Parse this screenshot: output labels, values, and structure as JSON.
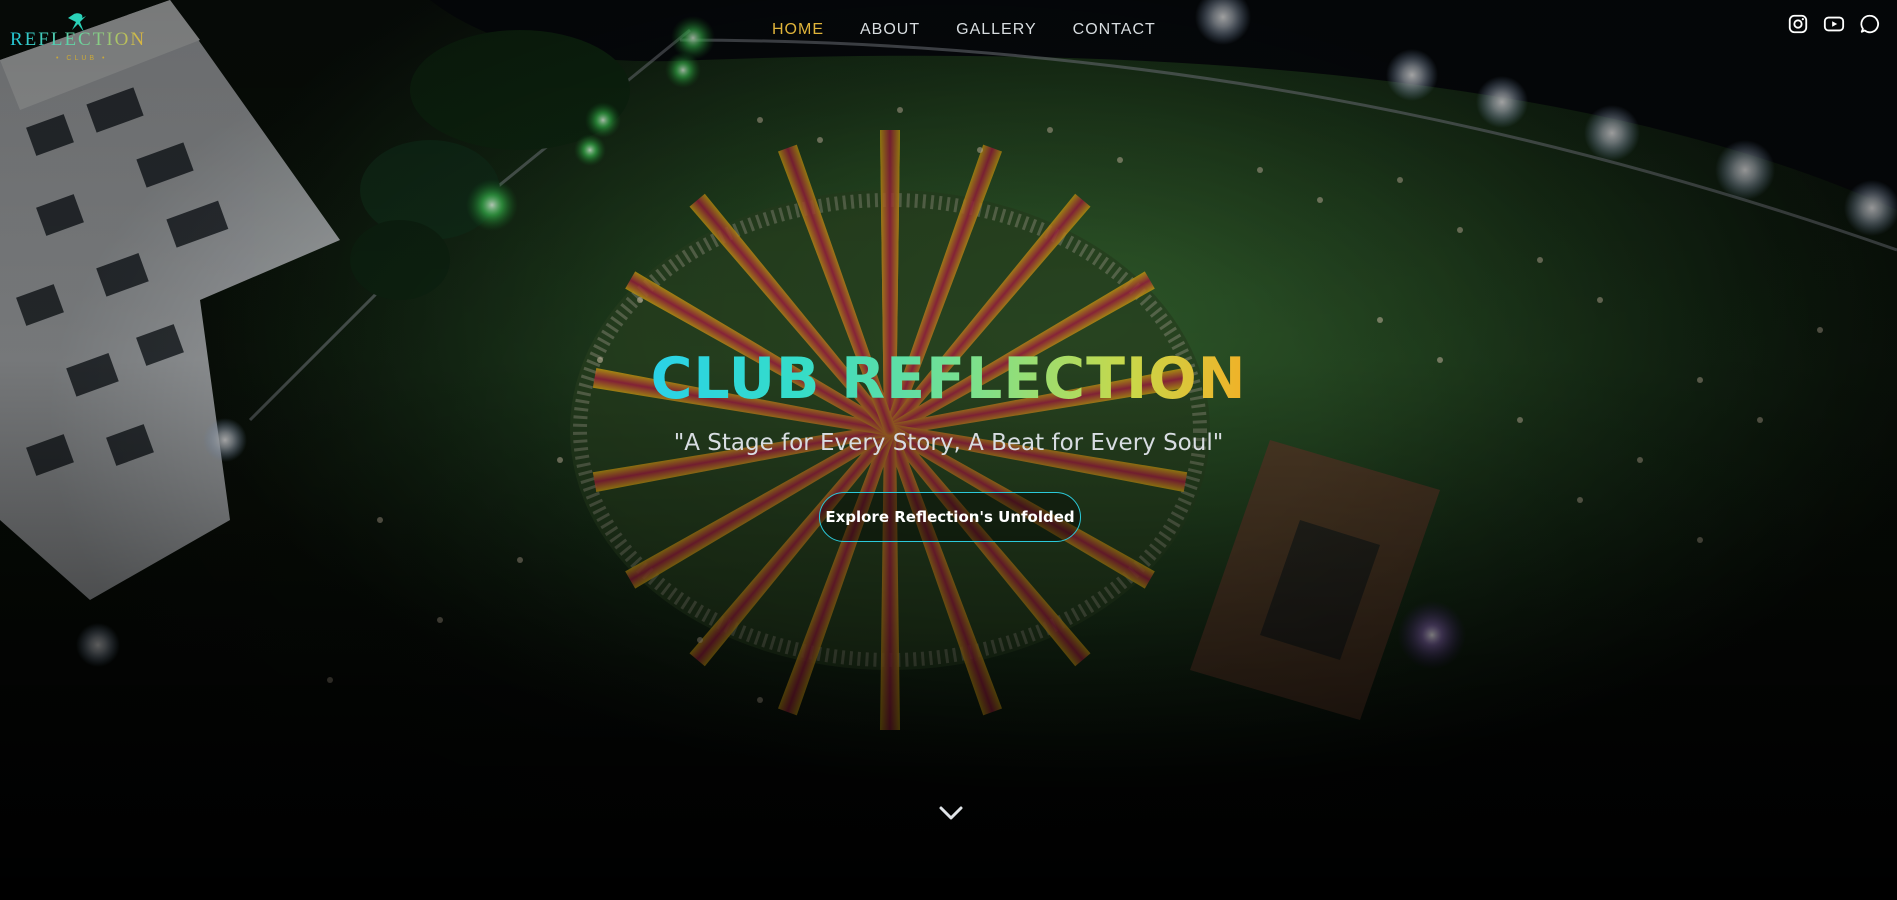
{
  "brand": {
    "logo_text": "REFLECTION",
    "logo_sub": "• CLUB •",
    "colors": {
      "cyan": "#2ad2e8",
      "green": "#7ee08a",
      "gold": "#e0b43a"
    }
  },
  "nav": {
    "items": [
      {
        "label": "HOME",
        "active": true
      },
      {
        "label": "ABOUT",
        "active": false
      },
      {
        "label": "GALLERY",
        "active": false
      },
      {
        "label": "CONTACT",
        "active": false
      }
    ]
  },
  "social": {
    "icons": [
      "instagram-icon",
      "youtube-icon",
      "whatsapp-icon"
    ]
  },
  "hero": {
    "title": "CLUB REFLECTION",
    "tagline": "\"A Stage for Every Story, A Beat for Every Soul\"",
    "cta_label": "Explore Reflection's Unfolded",
    "scroll_icon": "chevron-down-icon"
  }
}
